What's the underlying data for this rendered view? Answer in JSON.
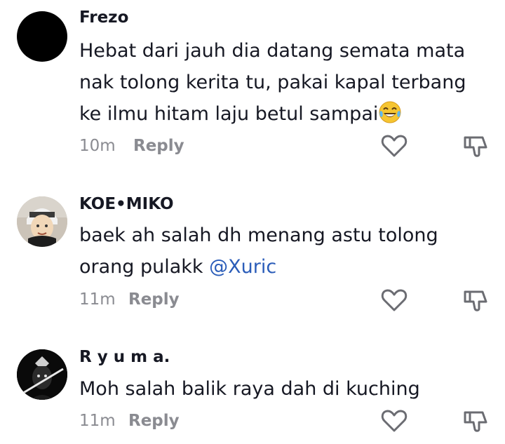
{
  "comments": [
    {
      "username": "Frezo",
      "text_lines": [
        "Hebat dari jauh dia datang semata mata",
        "nak tolong kerita tu, pakai kapal terbang",
        "ke ilmu hitam laju betul sampai"
      ],
      "emoji": "face-with-tears-of-joy",
      "time": "10m",
      "reply_label": "Reply"
    },
    {
      "username": "KOE•MIKO",
      "text_line_1": "baek ah salah dh menang astu tolong",
      "text_line_2": "orang pulakk",
      "mention": "@Xuric",
      "time": "11m",
      "reply_label": "Reply"
    },
    {
      "username": "R y u m a.",
      "text": "Moh salah balik raya dah di kuching",
      "time": "11m",
      "reply_label": "Reply"
    }
  ],
  "colors": {
    "text": "#161823",
    "muted": "#8a8b91",
    "mention": "#2b5db9",
    "icon": "#6b6c72"
  },
  "icons": {
    "like": "heart-outline-icon",
    "dislike": "thumbs-down-outline-icon"
  }
}
